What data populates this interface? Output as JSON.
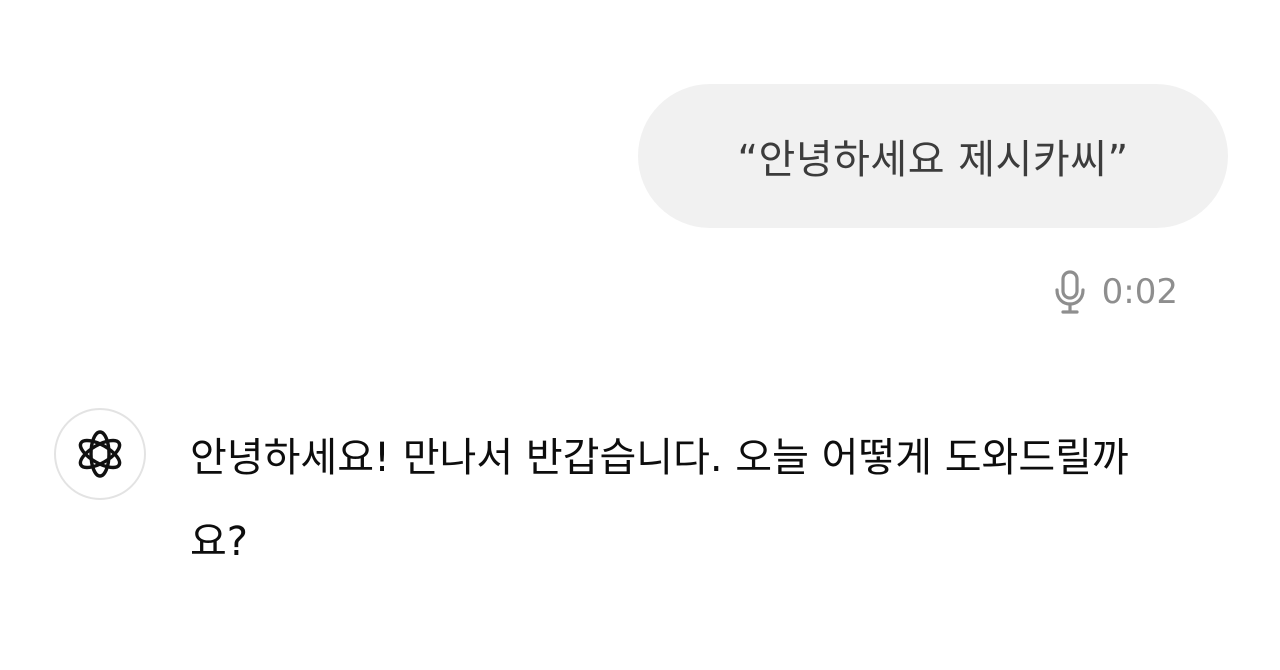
{
  "conversation": {
    "user_message": {
      "text": "“안녕하세요 제시카씨”",
      "input_mode_icon": "microphone-icon",
      "duration": "0:02"
    },
    "assistant_message": {
      "avatar_icon": "openai-logo-icon",
      "text": "안녕하세요! 만나서 반갑습니다. 오늘 어떻게 도와드릴까요?"
    }
  },
  "colors": {
    "user_bubble_bg": "#f1f1f1",
    "meta_gray": "#8e8e8e",
    "text_dark": "#0d0d0d"
  }
}
